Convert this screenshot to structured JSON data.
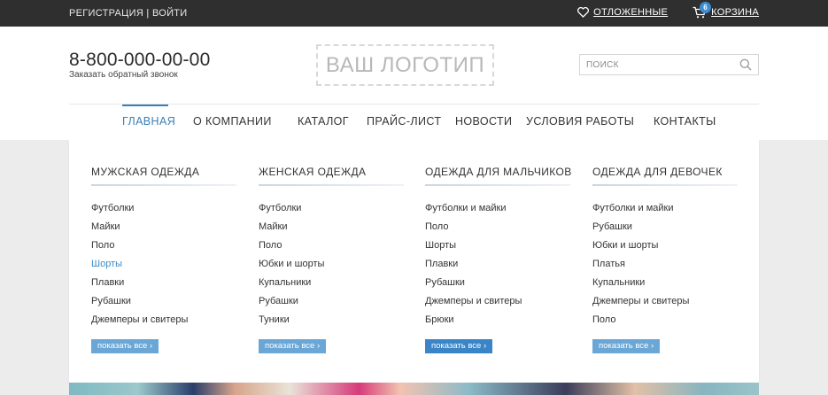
{
  "topbar": {
    "register": "РЕГИСТРАЦИЯ",
    "separator": "|",
    "login": "ВОЙТИ",
    "wishlist": "ОТЛОЖЕННЫЕ",
    "cart": "КОРЗИНА",
    "cart_count": "6"
  },
  "header": {
    "phone": "8-800-000-00-00",
    "callback": "Заказать обратный звонок",
    "logo": "ВАШ ЛОГОТИП",
    "search_placeholder": "ПОИСК"
  },
  "nav": {
    "items": [
      "ГЛАВНАЯ",
      "О КОМПАНИИ",
      "КАТАЛОГ",
      "ПРАЙС-ЛИСТ",
      "НОВОСТИ",
      "УСЛОВИЯ РАБОТЫ",
      "КОНТАКТЫ"
    ]
  },
  "menu": {
    "columns": [
      {
        "title": "МУЖСКАЯ ОДЕЖДА",
        "links": [
          "Футболки",
          "Майки",
          "Поло",
          "Шорты",
          "Плавки",
          "Рубашки",
          "Джемперы и свитеры"
        ],
        "more": "показать все ›"
      },
      {
        "title": "ЖЕНСКАЯ ОДЕЖДА",
        "links": [
          "Футболки",
          "Майки",
          "Поло",
          "Юбки и шорты",
          "Купальники",
          "Рубашки",
          "Туники"
        ],
        "more": "показать все ›"
      },
      {
        "title": "ОДЕЖДА ДЛЯ МАЛЬЧИКОВ",
        "links": [
          "Футболки и майки",
          "Поло",
          "Шорты",
          "Плавки",
          "Рубашки",
          "Джемперы и свитеры",
          "Брюки"
        ],
        "more": "показать все ›"
      },
      {
        "title": "ОДЕЖДА ДЛЯ ДЕВОЧЕК",
        "links": [
          "Футболки и майки",
          "Рубашки",
          "Юбки и шорты",
          "Платья",
          "Купальники",
          "Джемперы и свитеры",
          "Поло"
        ],
        "more": "показать все ›"
      }
    ]
  },
  "colors": {
    "accent": "#3b7fb6",
    "topbar_bg": "#2f2f2f",
    "badge": "#3d8dd4",
    "more_button": "#6aa7d6"
  }
}
